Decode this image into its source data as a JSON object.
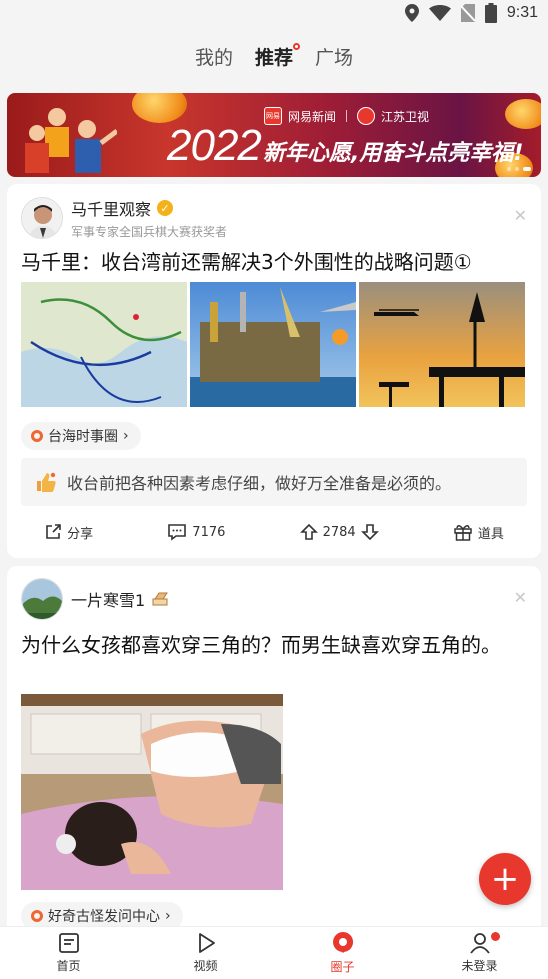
{
  "status_bar": {
    "time": "9:31"
  },
  "top_tabs": [
    {
      "label": "我的",
      "active": false
    },
    {
      "label": "推荐",
      "active": true
    },
    {
      "label": "广场",
      "active": false
    }
  ],
  "banner": {
    "brand1": "网易新闻",
    "brand2": "江苏卫视",
    "logo_text": "网易",
    "year": "2022",
    "slogan": "新年心愿,用奋斗点亮幸福!"
  },
  "posts": [
    {
      "author": "马千里观察",
      "author_sub": "军事专家全国兵棋大赛获奖者",
      "verified": true,
      "title": "马千里：收台湾前还需解决3个外围性的战略问题①",
      "tag": "台海时事圈",
      "tag_arrow": "›",
      "hot_comment": "收台前把各种因素考虑仔细，做好万全准备是必须的。",
      "actions": {
        "share": "分享",
        "comments": "7176",
        "votes": "2784",
        "props": "道具"
      }
    },
    {
      "author": "一片寒雪1",
      "title": "为什么女孩都喜欢穿三角的？而男生缺喜欢穿五角的。",
      "tag": "好奇古怪发问中心",
      "tag_arrow": "›"
    }
  ],
  "bottom_nav": [
    {
      "label": "首页",
      "icon": "home-icon",
      "active": false
    },
    {
      "label": "视频",
      "icon": "play-icon",
      "active": false
    },
    {
      "label": "圈子",
      "icon": "circle-chat-icon",
      "active": true
    },
    {
      "label": "未登录",
      "icon": "user-icon",
      "active": false,
      "badge": true
    }
  ],
  "fab_label": "+",
  "colors": {
    "accent": "#e8372c",
    "tag_dot": "#f0662e",
    "verified": "#f3b21a"
  }
}
